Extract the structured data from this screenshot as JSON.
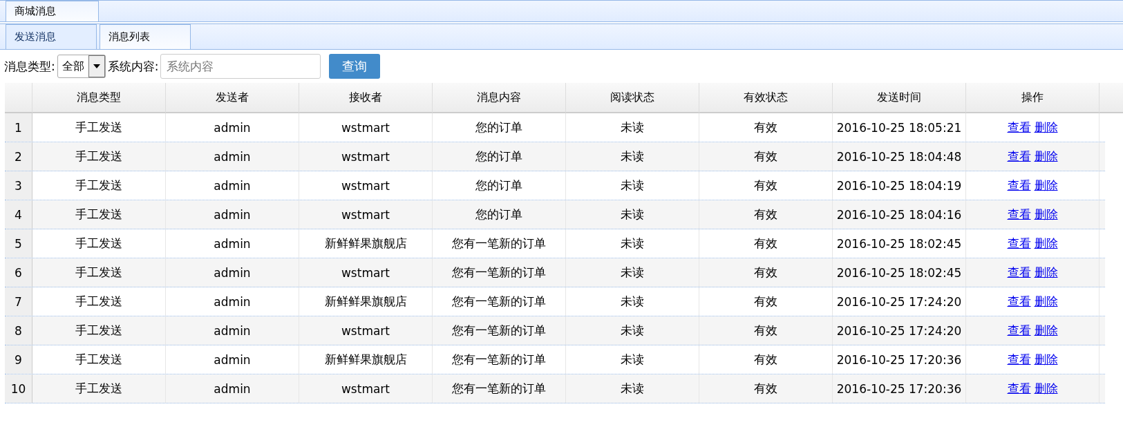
{
  "main_tabs": [
    {
      "label": "商城消息",
      "selected": true
    }
  ],
  "sub_tabs": [
    {
      "label": "发送消息",
      "selected": false
    },
    {
      "label": "消息列表",
      "selected": true
    }
  ],
  "filter": {
    "type_label": "消息类型:",
    "type_value": "全部",
    "content_label": "系统内容:",
    "content_placeholder": "系统内容",
    "search_button": "查询"
  },
  "table": {
    "columns": [
      "消息类型",
      "发送者",
      "接收者",
      "消息内容",
      "阅读状态",
      "有效状态",
      "发送时间",
      "操作"
    ],
    "rows": [
      {
        "index": "1",
        "cells": [
          "手工发送",
          "admin",
          "wstmart",
          "您的订单",
          "未读",
          "有效",
          "2016-10-25 18:05:21"
        ],
        "actions": [
          "查看",
          "删除"
        ]
      },
      {
        "index": "2",
        "cells": [
          "手工发送",
          "admin",
          "wstmart",
          "您的订单",
          "未读",
          "有效",
          "2016-10-25 18:04:48"
        ],
        "actions": [
          "查看",
          "删除"
        ]
      },
      {
        "index": "3",
        "cells": [
          "手工发送",
          "admin",
          "wstmart",
          "您的订单",
          "未读",
          "有效",
          "2016-10-25 18:04:19"
        ],
        "actions": [
          "查看",
          "删除"
        ]
      },
      {
        "index": "4",
        "cells": [
          "手工发送",
          "admin",
          "wstmart",
          "您的订单",
          "未读",
          "有效",
          "2016-10-25 18:04:16"
        ],
        "actions": [
          "查看",
          "删除"
        ]
      },
      {
        "index": "5",
        "cells": [
          "手工发送",
          "admin",
          "新鲜鲜果旗舰店",
          "您有一笔新的订单",
          "未读",
          "有效",
          "2016-10-25 18:02:45"
        ],
        "actions": [
          "查看",
          "删除"
        ]
      },
      {
        "index": "6",
        "cells": [
          "手工发送",
          "admin",
          "wstmart",
          "您有一笔新的订单",
          "未读",
          "有效",
          "2016-10-25 18:02:45"
        ],
        "actions": [
          "查看",
          "删除"
        ]
      },
      {
        "index": "7",
        "cells": [
          "手工发送",
          "admin",
          "新鲜鲜果旗舰店",
          "您有一笔新的订单",
          "未读",
          "有效",
          "2016-10-25 17:24:20"
        ],
        "actions": [
          "查看",
          "删除"
        ]
      },
      {
        "index": "8",
        "cells": [
          "手工发送",
          "admin",
          "wstmart",
          "您有一笔新的订单",
          "未读",
          "有效",
          "2016-10-25 17:24:20"
        ],
        "actions": [
          "查看",
          "删除"
        ]
      },
      {
        "index": "9",
        "cells": [
          "手工发送",
          "admin",
          "新鲜鲜果旗舰店",
          "您有一笔新的订单",
          "未读",
          "有效",
          "2016-10-25 17:20:36"
        ],
        "actions": [
          "查看",
          "删除"
        ]
      },
      {
        "index": "10",
        "cells": [
          "手工发送",
          "admin",
          "wstmart",
          "您有一笔新的订单",
          "未读",
          "有效",
          "2016-10-25 17:20:36"
        ],
        "actions": [
          "查看",
          "删除"
        ]
      }
    ]
  }
}
